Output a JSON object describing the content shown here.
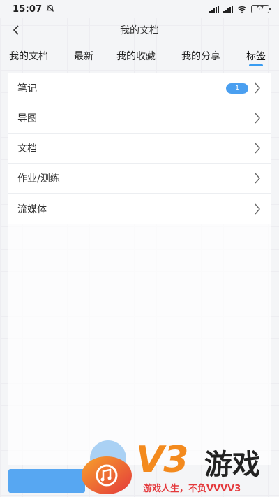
{
  "status_bar": {
    "time": "15:07",
    "battery": "57"
  },
  "header": {
    "title": "我的文档"
  },
  "tabs": [
    {
      "label": "我的文档",
      "active": false
    },
    {
      "label": "最新",
      "active": false
    },
    {
      "label": "我的收藏",
      "active": false
    },
    {
      "label": "我的分享",
      "active": false
    },
    {
      "label": "标签",
      "active": true
    }
  ],
  "list": {
    "items": [
      {
        "label": "笔记",
        "badge": "1"
      },
      {
        "label": "导图"
      },
      {
        "label": "文档"
      },
      {
        "label": "作业/测练"
      },
      {
        "label": "流媒体"
      }
    ]
  },
  "watermark": {
    "brand": "V3",
    "brand_suffix": "游戏",
    "slogan": "游戏人生，不负VVVV3"
  },
  "colors": {
    "accent": "#3a9cf1",
    "badge": "#4a9ff0",
    "watermark_orange": "#f38a1e",
    "watermark_red": "#e4393c"
  }
}
